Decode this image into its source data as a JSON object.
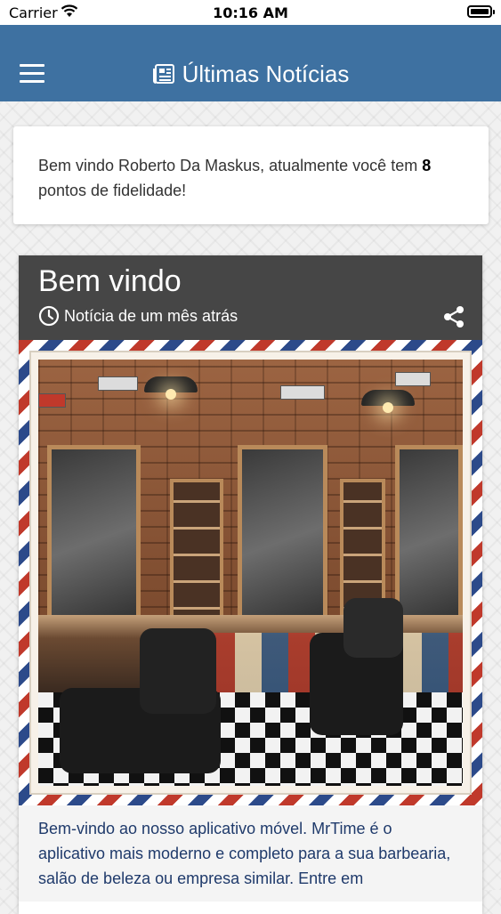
{
  "status_bar": {
    "carrier": "Carrier",
    "time": "10:16 AM",
    "wifi_icon": "wifi-icon",
    "battery_icon": "battery-icon"
  },
  "header": {
    "title": "Últimas Notícias",
    "menu_icon": "hamburger-menu-icon",
    "title_icon": "newspaper-icon",
    "background_color": "#3e71a1"
  },
  "welcome": {
    "text_before": "Bem vindo Roberto Da Maskus, atualmente você tem ",
    "points": "8",
    "text_after": " pontos de fidelidade!"
  },
  "news": [
    {
      "title": "Bem vindo",
      "time_ago": "Notícia de um mês atrás",
      "time_icon": "clock-icon",
      "share_icon": "share-icon",
      "image_icon": "barbershop-photo",
      "body": "Bem-vindo ao nosso aplicativo móvel. MrTime é o aplicativo mais moderno e completo para a sua barbearia, salão de beleza ou empresa similar. Entre em"
    }
  ],
  "colors": {
    "accent": "#3e71a1",
    "card_header": "#464646",
    "body_text": "#1f3a6b"
  }
}
